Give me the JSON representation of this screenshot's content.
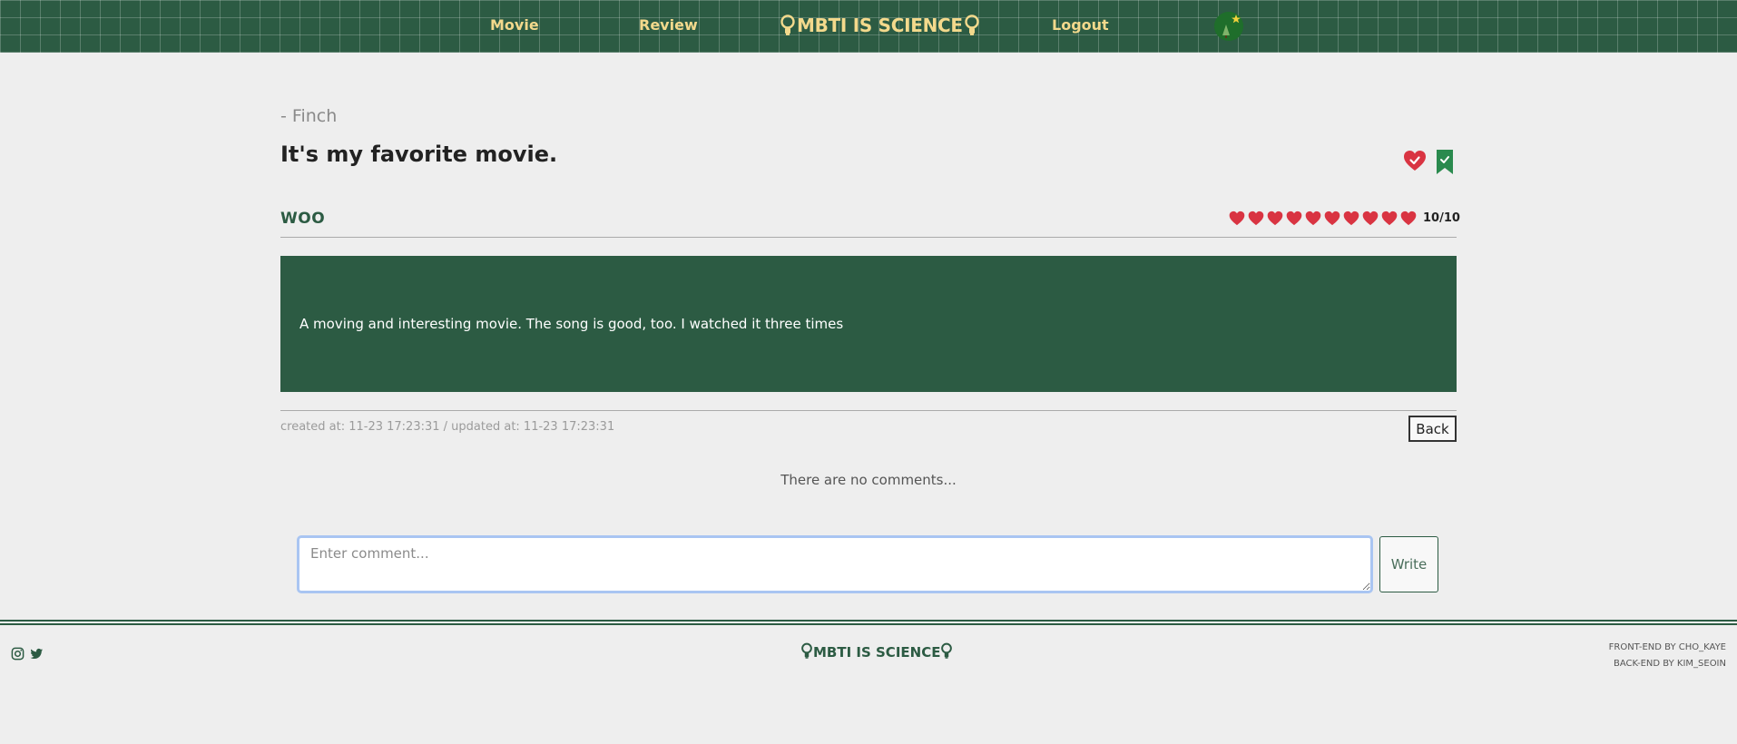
{
  "nav": {
    "movie": "Movie",
    "review": "Review",
    "brand": "MBTI IS SCIENCE",
    "logout": "Logout",
    "avatar_icon": "profile-avatar-icon"
  },
  "review": {
    "author": "- Finch",
    "title": "It's my favorite movie.",
    "movie_name": "WOO",
    "rating_value": 10,
    "rating_max": 10,
    "rating_text": "10/10",
    "content": "A moving and interesting movie. The song is good, too. I watched it three times",
    "meta": "created at: 11-23 17:23:31 / updated at: 11-23 17:23:31",
    "liked": true,
    "bookmarked": true
  },
  "actions": {
    "back": "Back",
    "write": "Write"
  },
  "comments": {
    "empty_text": "There are no comments...",
    "placeholder": "Enter comment..."
  },
  "footer": {
    "brand": "MBTI IS SCIENCE",
    "frontend_credit": "FRONT-END BY CHO_KAYE",
    "backend_credit": "BACK-END BY KIM_SEOIN",
    "social_icons": [
      "instagram-icon",
      "twitter-icon"
    ]
  },
  "colors": {
    "primary_green": "#2c5b43",
    "nav_text": "#f3d98c",
    "heart_red": "#d93442",
    "background": "#eeeeee"
  }
}
